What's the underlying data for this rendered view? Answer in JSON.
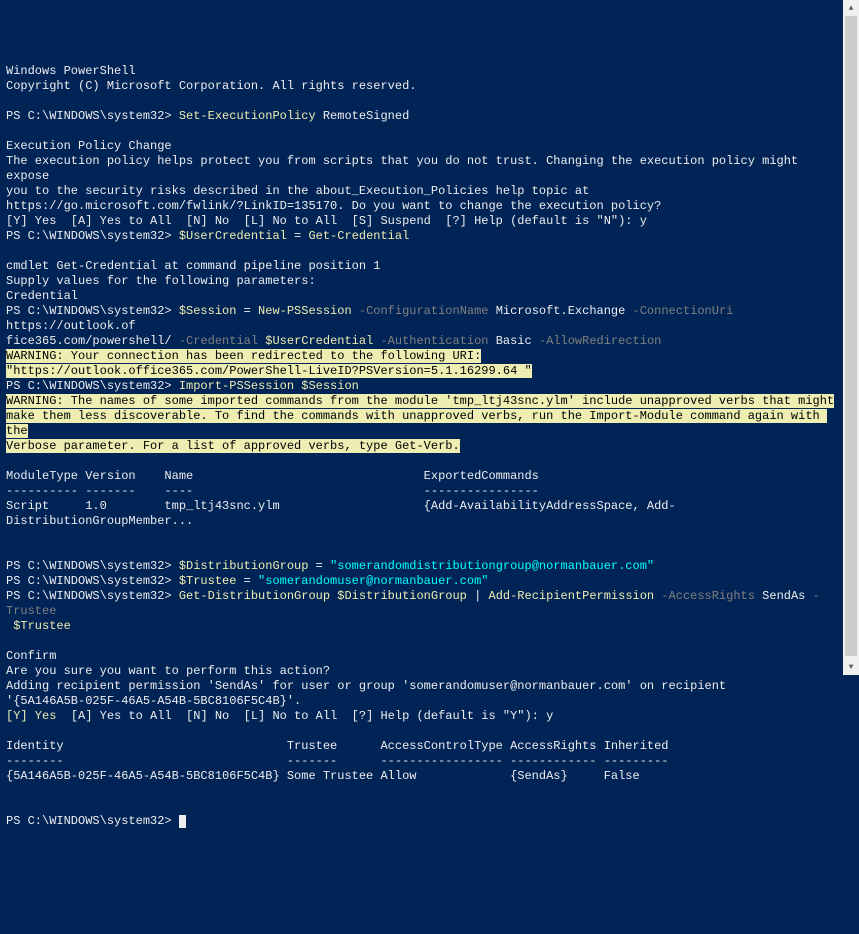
{
  "header": {
    "line1": "Windows PowerShell",
    "line2": "Copyright (C) Microsoft Corporation. All rights reserved."
  },
  "ps": "PS C:\\WINDOWS\\system32> ",
  "cmd1": {
    "cmd": "Set-ExecutionPolicy",
    "arg": " RemoteSigned"
  },
  "policy": {
    "title": "Execution Policy Change",
    "body1": "The execution policy helps protect you from scripts that you do not trust. Changing the execution policy might expose",
    "body2": "you to the security risks described in the about_Execution_Policies help topic at",
    "body3": "https://go.microsoft.com/fwlink/?LinkID=135170. Do you want to change the execution policy?",
    "prompt": "[Y] Yes  [A] Yes to All  [N] No  [L] No to All  [S] Suspend  [?] Help (default is \"N\"): y"
  },
  "cmd2": {
    "var": "$UserCredential",
    "eq": " = ",
    "cmd": "Get-Credential"
  },
  "cred": {
    "l1": "cmdlet Get-Credential at command pipeline position 1",
    "l2": "Supply values for the following parameters:",
    "l3": "Credential"
  },
  "cmd3": {
    "var": "$Session",
    "eq": " = ",
    "cmd": "New-PSSession",
    "p1": " -ConfigurationName",
    "v1": " Microsoft.Exchange",
    "p2": " -ConnectionUri",
    "v2a": " https://outlook.of",
    "v2b": "fice365.com/powershell/",
    "p3": " -Credential",
    "v3": " $UserCredential",
    "p4": " -Authentication",
    "v4": " Basic",
    "p5": " -AllowRedirection"
  },
  "warn1": {
    "l1": "WARNING: Your connection has been redirected to the following URI:",
    "l2": "\"https://outlook.office365.com/PowerShell-LiveID?PSVersion=5.1.16299.64 \""
  },
  "cmd4": {
    "cmd": "Import-PSSession",
    "arg": " $Session"
  },
  "warn2": {
    "l1": "WARNING: The names of some imported commands from the module 'tmp_ltj43snc.ylm' include unapproved verbs that might",
    "l2": "make them less discoverable. To find the commands with unapproved verbs, run the Import-Module command again with the",
    "l3": "Verbose parameter. For a list of approved verbs, type Get-Verb."
  },
  "table1": {
    "header": "ModuleType Version    Name                                ExportedCommands",
    "div": "---------- -------    ----                                ----------------",
    "row": "Script     1.0        tmp_ltj43snc.ylm                    {Add-AvailabilityAddressSpace, Add-DistributionGroupMember..."
  },
  "cmd5": {
    "var": "$DistributionGroup",
    "eq": " = ",
    "val": "\"somerandomdistributiongroup@normanbauer.com\""
  },
  "cmd6": {
    "var": "$Trustee",
    "eq": " = ",
    "val": "\"somerandomuser@normanbauer.com\""
  },
  "cmd7": {
    "cmd1": "Get-DistributionGroup",
    "arg1": " $DistributionGroup",
    "pipe": " | ",
    "cmd2": "Add-RecipientPermission",
    "p1": " -AccessRights",
    "v1": " SendAs",
    "p2": " -Trustee",
    "v2": " $Trustee"
  },
  "confirm": {
    "title": "Confirm",
    "q": "Are you sure you want to perform this action?",
    "l1": "Adding recipient permission 'SendAs' for user or group 'somerandomuser@normanbauer.com' on recipient",
    "l2": "'{5A146A5B-025F-46A5-A54B-5BC8106F5C4B}'.",
    "prompt": "[Y] Yes  [A] Yes to All  [N] No  [L] No to All  [?] Help (default is \"Y\"): y",
    "yes": "[Y] Yes"
  },
  "table2": {
    "header": "Identity                               Trustee      AccessControlType AccessRights Inherited",
    "div": "--------                               -------      ----------------- ------------ ---------",
    "row": "{5A146A5B-025F-46A5-A54B-5BC8106F5C4B} Some Trustee Allow             {SendAs}     False"
  }
}
